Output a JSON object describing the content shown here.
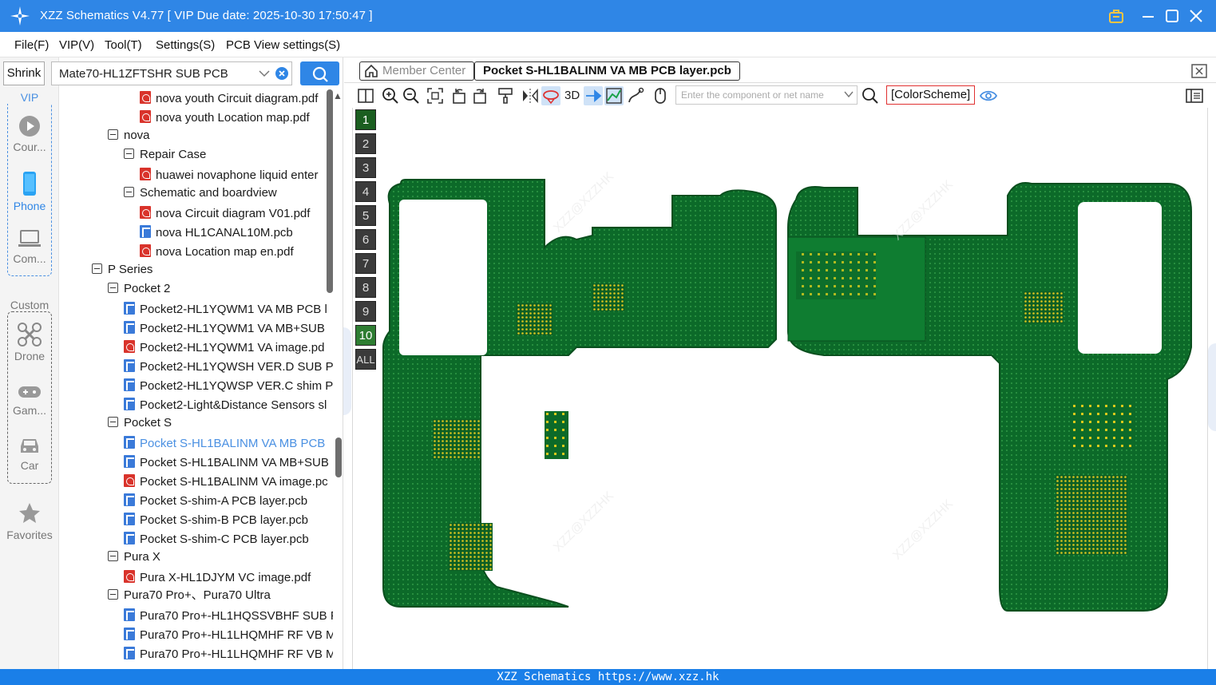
{
  "window": {
    "title": "XZZ Schematics V4.77 [ VIP Due date: 2025-10-30 17:50:47 ]"
  },
  "menu": [
    "File(F)",
    "VIP(V)",
    "Tool(T)",
    "Settings(S)",
    "PCB View settings(S)"
  ],
  "left_panel": {
    "shrink_label": "Shrink",
    "vip_label": "VIP",
    "custom_label": "Custom",
    "items": [
      {
        "label": "Cour...",
        "icon": "play-icon"
      },
      {
        "label": "Phone",
        "icon": "phone-icon",
        "active": true
      },
      {
        "label": "Com...",
        "icon": "laptop-icon"
      },
      {
        "label": "Drone",
        "icon": "drone-icon"
      },
      {
        "label": "Gam...",
        "icon": "gamepad-icon"
      },
      {
        "label": "Car",
        "icon": "car-icon"
      }
    ],
    "favorites_label": "Favorites"
  },
  "search": {
    "value": "Mate70-HL1ZFTSHR SUB PCB"
  },
  "tree": [
    {
      "label": "nova youth Circuit diagram.pdf",
      "type": "pdf",
      "level": 3
    },
    {
      "label": "nova youth Location map.pdf",
      "type": "pdf",
      "level": 3
    },
    {
      "label": "nova",
      "type": "folder",
      "level": 1
    },
    {
      "label": "Repair Case",
      "type": "folder",
      "level": 2
    },
    {
      "label": "huawei novaphone liquid enter",
      "type": "pdf",
      "level": 3
    },
    {
      "label": "Schematic and boardview",
      "type": "folder",
      "level": 2
    },
    {
      "label": "nova Circuit diagram V01.pdf",
      "type": "pdf",
      "level": 3
    },
    {
      "label": "nova HL1CANAL10M.pcb",
      "type": "pcb",
      "level": 3
    },
    {
      "label": "nova Location map en.pdf",
      "type": "pdf",
      "level": 3
    },
    {
      "label": "P Series",
      "type": "folder",
      "level": 0
    },
    {
      "label": "Pocket 2",
      "type": "folder",
      "level": 1
    },
    {
      "label": "Pocket2-HL1YQWM1 VA MB PCB l",
      "type": "pcb",
      "level": 2
    },
    {
      "label": "Pocket2-HL1YQWM1 VA MB+SUB",
      "type": "pcb",
      "level": 2
    },
    {
      "label": "Pocket2-HL1YQWM1 VA image.pd",
      "type": "pdf",
      "level": 2
    },
    {
      "label": "Pocket2-HL1YQWSH VER.D SUB PC",
      "type": "pcb",
      "level": 2
    },
    {
      "label": "Pocket2-HL1YQWSP VER.C shim PC",
      "type": "pcb",
      "level": 2
    },
    {
      "label": "Pocket2-Light&Distance Sensors sl",
      "type": "pcb",
      "level": 2
    },
    {
      "label": "Pocket S",
      "type": "folder",
      "level": 1
    },
    {
      "label": "Pocket S-HL1BALINM VA MB PCB",
      "type": "pcb",
      "level": 2,
      "selected": true
    },
    {
      "label": "Pocket S-HL1BALINM VA MB+SUB",
      "type": "pcb",
      "level": 2
    },
    {
      "label": "Pocket S-HL1BALINM VA image.pc",
      "type": "pdf",
      "level": 2
    },
    {
      "label": "Pocket S-shim-A PCB layer.pcb",
      "type": "pcb",
      "level": 2
    },
    {
      "label": "Pocket S-shim-B PCB layer.pcb",
      "type": "pcb",
      "level": 2
    },
    {
      "label": "Pocket S-shim-C PCB layer.pcb",
      "type": "pcb",
      "level": 2
    },
    {
      "label": "Pura X",
      "type": "folder",
      "level": 1
    },
    {
      "label": "Pura X-HL1DJYM VC image.pdf",
      "type": "pdf",
      "level": 2
    },
    {
      "label": "Pura70 Pro+、Pura70 Ultra",
      "type": "folder",
      "level": 1
    },
    {
      "label": "Pura70 Pro+-HL1HQSSVBHF SUB F",
      "type": "pcb",
      "level": 2
    },
    {
      "label": "Pura70 Pro+-HL1LHQMHF RF VB M",
      "type": "pcb",
      "level": 2
    },
    {
      "label": "Pura70 Pro+-HL1LHQMHF RF VB M",
      "type": "pcb",
      "level": 2
    }
  ],
  "tabs": {
    "member": "Member Center",
    "active": "Pocket S-HL1BALINM VA MB PCB layer.pcb"
  },
  "toolbar": {
    "three_d": "3D",
    "net_placeholder": "Enter the component or net name",
    "color_scheme": "[ColorScheme]"
  },
  "layers": [
    "1",
    "2",
    "3",
    "4",
    "5",
    "6",
    "7",
    "8",
    "9",
    "10",
    "ALL"
  ],
  "watermark": "XZZ@XZZHK",
  "status": "XZZ Schematics https://www.xzz.hk",
  "colors": {
    "accent": "#2f86e6",
    "pcb_green": "#0d6b2a",
    "pad_yellow": "#e8d619"
  }
}
